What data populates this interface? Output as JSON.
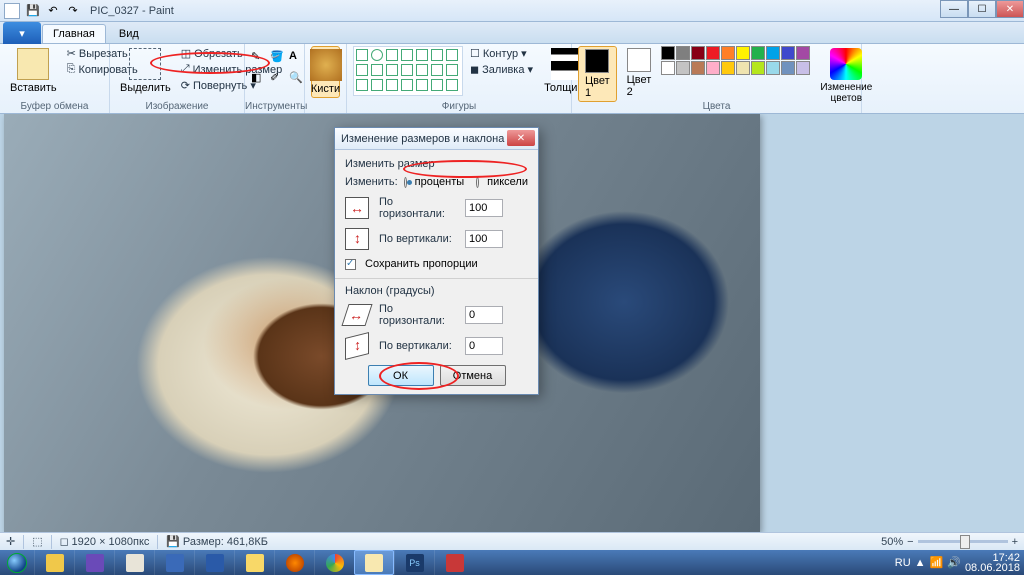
{
  "app": {
    "title": "PIC_0327 - Paint"
  },
  "tabs": {
    "active": "Главная",
    "view": "Вид"
  },
  "ribbon": {
    "clipboard": {
      "paste": "Вставить",
      "cut": "Вырезать",
      "copy": "Копировать",
      "label": "Буфер обмена"
    },
    "image": {
      "select": "Выделить",
      "crop": "Обрезать",
      "resize": "Изменить размер",
      "rotate": "Повернуть ▾",
      "label": "Изображение"
    },
    "tools": {
      "label": "Инструменты"
    },
    "brushes": {
      "label": "Кисти"
    },
    "shapes": {
      "outline": "Контур ▾",
      "fill": "Заливка ▾",
      "thickness": "Толщина",
      "label": "Фигуры"
    },
    "colors": {
      "c1": "Цвет 1",
      "c2": "Цвет 2",
      "edit": "Изменение цветов",
      "label": "Цвета"
    },
    "palette": [
      "#000",
      "#7f7f7f",
      "#880015",
      "#ed1c24",
      "#ff7f27",
      "#fff200",
      "#22b14c",
      "#00a2e8",
      "#3f48cc",
      "#a349a4",
      "#fff",
      "#c3c3c3",
      "#b97a57",
      "#ffaec9",
      "#ffc90e",
      "#efe4b0",
      "#b5e61d",
      "#99d9ea",
      "#7092be",
      "#c8bfe7"
    ]
  },
  "dialog": {
    "title": "Изменение размеров и наклона",
    "resize": {
      "legend": "Изменить размер",
      "by": "Изменить:",
      "percent": "проценты",
      "pixels": "пиксели",
      "horiz": "По горизонтали:",
      "vert": "По вертикали:",
      "hval": "100",
      "vval": "100",
      "keep": "Сохранить пропорции"
    },
    "skew": {
      "legend": "Наклон (градусы)",
      "horiz": "По горизонтали:",
      "vert": "По вертикали:",
      "hval": "0",
      "vval": "0"
    },
    "ok": "ОК",
    "cancel": "Отмена"
  },
  "status": {
    "dims": "1920 × 1080пкс",
    "size": "Размер: 461,8КБ",
    "zoom": "50%",
    "pos_label": ""
  },
  "systray": {
    "lang": "RU",
    "time": "17:42",
    "date": "08.06.2018"
  }
}
